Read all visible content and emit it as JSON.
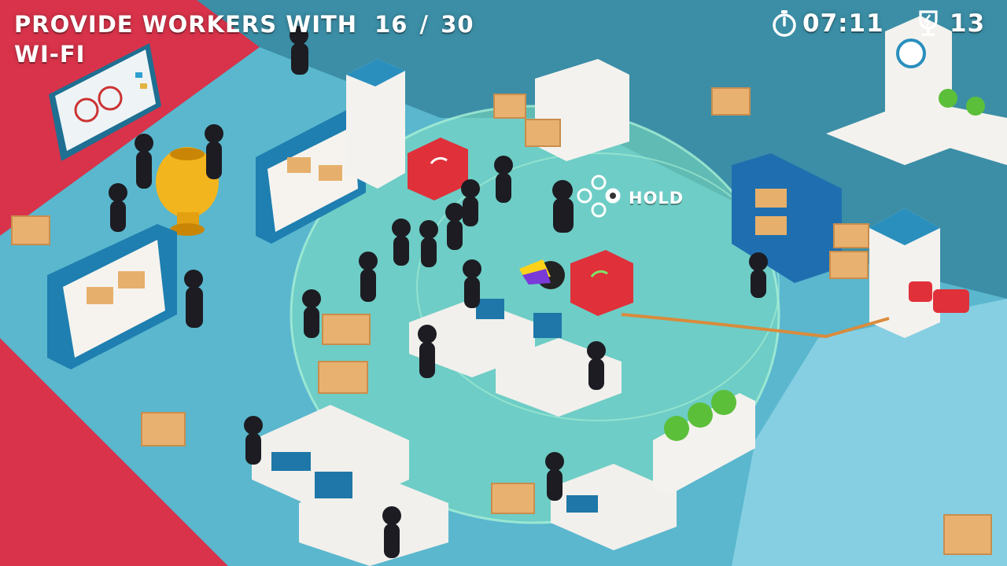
{
  "hud": {
    "objective_line1": "PROVIDE WORKERS WITH",
    "objective_line2": "WI-FI",
    "progress": "16 / 30",
    "timer": "07:11",
    "score": "13",
    "timer_icon": "stopwatch-icon",
    "score_icon": "trophy-bolt-icon"
  },
  "prompt": {
    "label": "HOLD",
    "icon": "joystick-hold-icon"
  },
  "colors": {
    "floor": "#5bb8cf",
    "carpet": "#d8334a",
    "wifi_zone": "#7fe0c0",
    "router": "#e0303a",
    "hud_text": "#ffffff"
  }
}
